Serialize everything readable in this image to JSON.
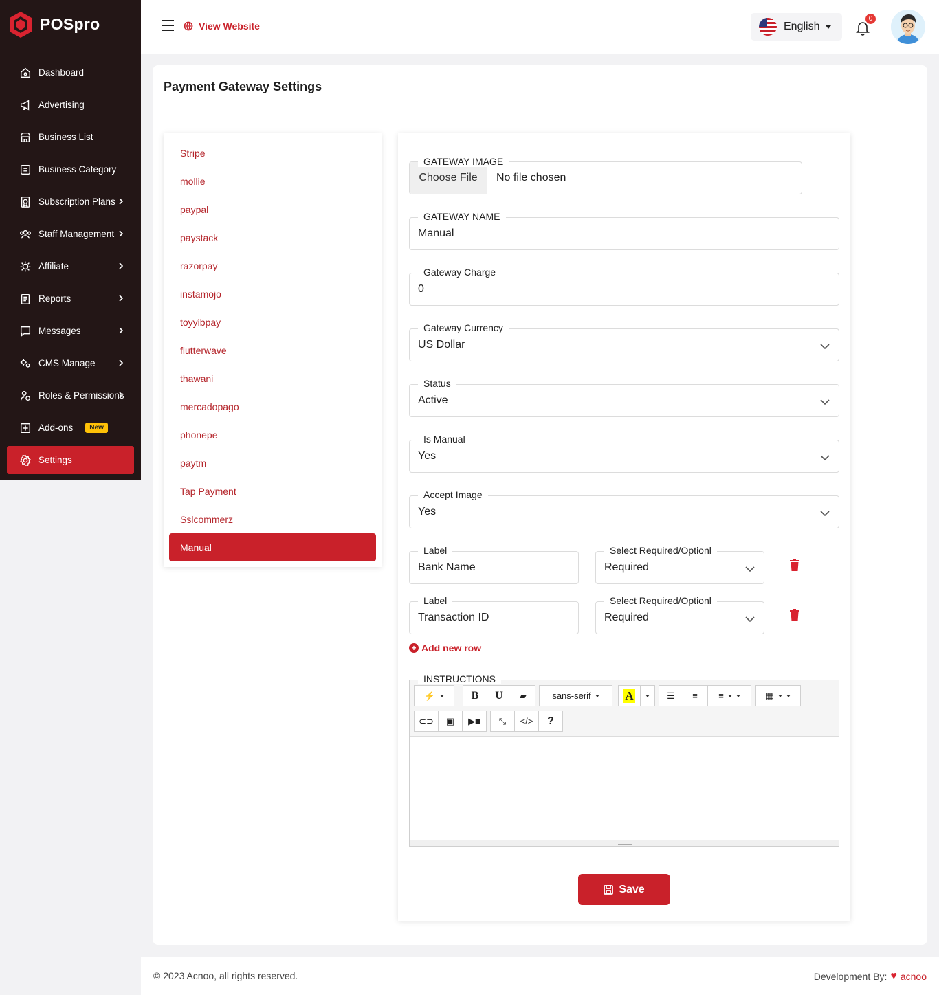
{
  "brand": {
    "name": "POSpro"
  },
  "sidebar": {
    "items": [
      {
        "label": "Dashboard",
        "icon": "home-icon",
        "chevron": false
      },
      {
        "label": "Advertising",
        "icon": "megaphone-icon",
        "chevron": false
      },
      {
        "label": "Business List",
        "icon": "store-icon",
        "chevron": false
      },
      {
        "label": "Business Category",
        "icon": "category-icon",
        "chevron": false
      },
      {
        "label": "Subscription Plans",
        "icon": "plan-icon",
        "chevron": true
      },
      {
        "label": "Staff Management",
        "icon": "users-icon",
        "chevron": true
      },
      {
        "label": "Affiliate",
        "icon": "affiliate-icon",
        "chevron": true
      },
      {
        "label": "Reports",
        "icon": "report-icon",
        "chevron": true
      },
      {
        "label": "Messages",
        "icon": "message-icon",
        "chevron": true
      },
      {
        "label": "CMS Manage",
        "icon": "cog-icon",
        "chevron": true
      },
      {
        "label": "Roles & Permissions",
        "icon": "roles-icon",
        "chevron": true
      },
      {
        "label": "Add-ons",
        "icon": "plus-square-icon",
        "badge": "New"
      },
      {
        "label": "Settings",
        "icon": "settings-icon",
        "active": true
      }
    ]
  },
  "topbar": {
    "view_website": "View Website",
    "language": "English",
    "notification_count": "0"
  },
  "page": {
    "title": "Payment Gateway Settings"
  },
  "gateways": [
    "Stripe",
    "mollie",
    "paypal",
    "paystack",
    "razorpay",
    "instamojo",
    "toyyibpay",
    "flutterwave",
    "thawani",
    "mercadopago",
    "phonepe",
    "paytm",
    "Tap Payment",
    "Sslcommerz",
    "Manual"
  ],
  "active_gateway": "Manual",
  "form": {
    "gateway_image": {
      "label": "GATEWAY IMAGE",
      "button": "Choose File",
      "status": "No file chosen"
    },
    "gateway_name": {
      "label": "GATEWAY NAME",
      "value": "Manual"
    },
    "gateway_charge": {
      "label": "Gateway Charge",
      "value": "0"
    },
    "gateway_currency": {
      "label": "Gateway Currency",
      "value": "US Dollar"
    },
    "status": {
      "label": "Status",
      "value": "Active"
    },
    "is_manual": {
      "label": "Is Manual",
      "value": "Yes"
    },
    "accept_image": {
      "label": "Accept Image",
      "value": "Yes"
    },
    "rows": [
      {
        "label_title": "Label",
        "label_value": "Bank Name",
        "req_title": "Select Required/Optionl",
        "req_value": "Required"
      },
      {
        "label_title": "Label",
        "label_value": "Transaction ID",
        "req_title": "Select Required/Optionl",
        "req_value": "Required"
      }
    ],
    "add_row": "Add new row",
    "instructions": {
      "label": "INSTRUCTIONS",
      "font": "sans-serif",
      "bold": "B",
      "underline": "U",
      "color_glyph": "A",
      "code": "</>",
      "help": "?"
    },
    "save": "Save"
  },
  "footer": {
    "copyright": "© 2023 Acnoo, all rights reserved.",
    "dev_label": "Development By:",
    "dev_company": "acnoo"
  },
  "colors": {
    "accent": "#c9212a",
    "sidebar_bg": "#231616",
    "badge": "#ffc107"
  }
}
